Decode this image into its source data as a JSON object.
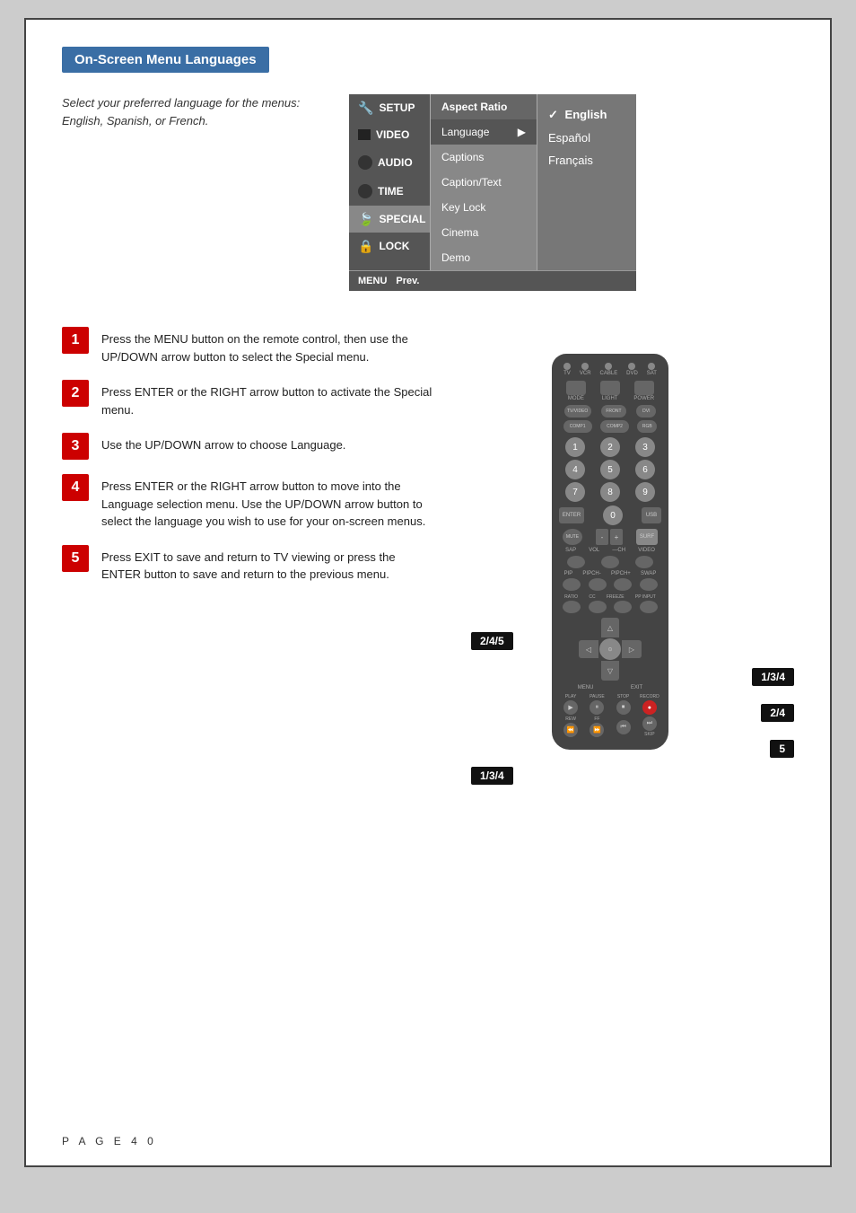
{
  "page": {
    "header": "On-Screen Menu Languages",
    "page_number": "P A G E   4 0",
    "description": "Select your preferred language for the menus: English, Spanish, or French."
  },
  "menu": {
    "left_items": [
      {
        "label": "SETUP",
        "icon": "wrench",
        "active": false
      },
      {
        "label": "VIDEO",
        "icon": "rect",
        "active": false
      },
      {
        "label": "AUDIO",
        "icon": "circle",
        "active": false
      },
      {
        "label": "TIME",
        "icon": "clock",
        "active": false
      },
      {
        "label": "SPECIAL",
        "icon": "leaf",
        "active": true
      },
      {
        "label": "LOCK",
        "icon": "lock",
        "active": false
      }
    ],
    "mid_items": [
      {
        "label": "Aspect Ratio",
        "type": "top"
      },
      {
        "label": "Language",
        "arrow": true,
        "type": "selected"
      },
      {
        "label": "Captions",
        "type": "normal"
      },
      {
        "label": "Caption/Text",
        "type": "normal"
      },
      {
        "label": "Key Lock",
        "type": "normal"
      },
      {
        "label": "Cinema",
        "type": "normal"
      },
      {
        "label": "Demo",
        "type": "normal"
      }
    ],
    "right_items": [
      {
        "label": "English",
        "selected": true
      },
      {
        "label": "Español",
        "selected": false
      },
      {
        "label": "Français",
        "selected": false
      }
    ],
    "bottom": {
      "menu_label": "MENU",
      "prev_label": "Prev."
    }
  },
  "steps": [
    {
      "number": "1",
      "text": "Press the MENU button on the remote control, then use the UP/DOWN arrow button to select the Special menu."
    },
    {
      "number": "2",
      "text": "Press ENTER or the RIGHT arrow button to activate the Special menu."
    },
    {
      "number": "3",
      "text": "Use the UP/DOWN arrow to choose Language."
    },
    {
      "number": "4",
      "text": "Press ENTER or the RIGHT arrow button to move into the Language selection menu. Use the UP/DOWN arrow button to select the language you wish to use for your on-screen menus."
    },
    {
      "number": "5",
      "text": "Press EXIT to save and return to TV viewing or press the ENTER button to save and return to the previous menu."
    }
  ],
  "callouts": {
    "c245": "2/4/5",
    "c134": "1/3/4",
    "c24": "2/4",
    "c5": "5",
    "c134b": "1/3/4"
  },
  "remote": {
    "top_labels": [
      "TV",
      "VCR",
      "CABLE",
      "DVD",
      "SAT"
    ],
    "row1": [
      "MODE",
      "LIGHT",
      "POWER"
    ],
    "row2": [
      "TV/VIDEO",
      "FRONT",
      "DVI"
    ],
    "row3": [
      "COMP1",
      "COMP2",
      "RGB"
    ],
    "numpad": [
      "1",
      "2",
      "3",
      "4",
      "5",
      "6",
      "7",
      "8",
      "9"
    ],
    "row_center": [
      "ENTER",
      "0",
      "USB"
    ],
    "row_surf": [
      "MUTE",
      "",
      "SURF"
    ],
    "row_vol": [
      "SAP",
      "VOL-",
      "+",
      "CH-",
      "CH+",
      "VIDEO"
    ],
    "row_pip": [
      "PIP",
      "PIPCH-",
      "PIPCH+",
      "SWAP"
    ],
    "row_func": [
      "RATIO",
      "CC",
      "FREEZE",
      "PP INPUT"
    ],
    "nav": [
      "△",
      "◁",
      "⊙",
      "▷",
      "▽"
    ],
    "nav_labels": [
      "MENU",
      "",
      "EXIT"
    ],
    "transport_labels": [
      "PLAY",
      "PAUSE",
      "STOP",
      "RECORD"
    ],
    "rw_labels": [
      "REW",
      "FF",
      "",
      "SKIP"
    ]
  }
}
